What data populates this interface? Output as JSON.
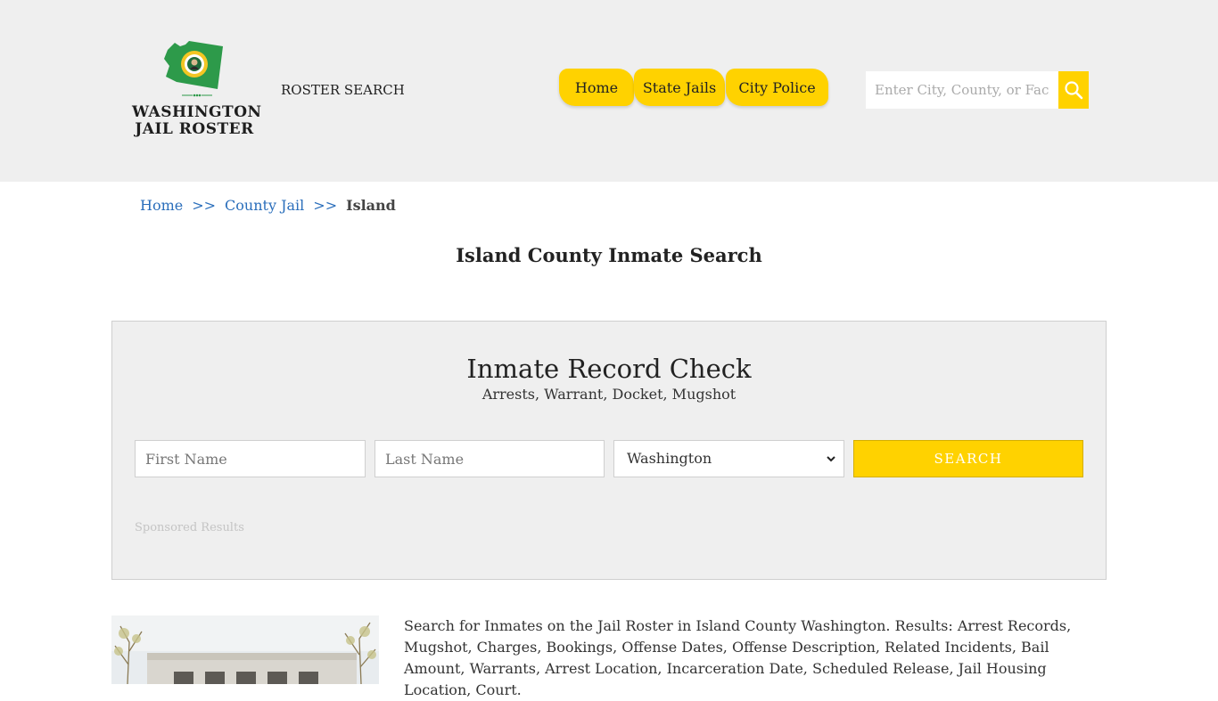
{
  "header": {
    "logo": {
      "line1": "WASHINGTON",
      "line2": "JAIL ROSTER"
    },
    "roster_search_label": "ROSTER SEARCH",
    "nav": {
      "home": "Home",
      "state_jails": "State Jails",
      "city_police": "City Police"
    },
    "search": {
      "placeholder": "Enter City, County, or Facility"
    }
  },
  "breadcrumb": {
    "home": "Home",
    "sep": ">>",
    "county_jail": "County Jail",
    "current": "Island"
  },
  "page_title": "Island County Inmate Search",
  "record_check": {
    "title": "Inmate Record Check",
    "subtitle": "Arrests, Warrant, Docket, Mugshot",
    "first_name_placeholder": "First Name",
    "last_name_placeholder": "Last Name",
    "state_selected": "Washington",
    "submit_label": "SEARCH",
    "sponsored": "Sponsored Results"
  },
  "description": "Search for Inmates on the Jail Roster in Island County Washington. Results: Arrest Records, Mugshot, Charges, Bookings, Offense Dates, Offense Description, Related Incidents, Bail Amount, Warrants, Arrest Location, Incarceration Date, Scheduled Release, Jail Housing Location, Court.",
  "colors": {
    "accent": "#ffd200",
    "header_bg": "#efefef",
    "link": "#2a6ebb",
    "map_green": "#2d9a4a"
  },
  "icons": [
    "washington-state-map-icon",
    "search-icon",
    "chevron-down-icon"
  ]
}
